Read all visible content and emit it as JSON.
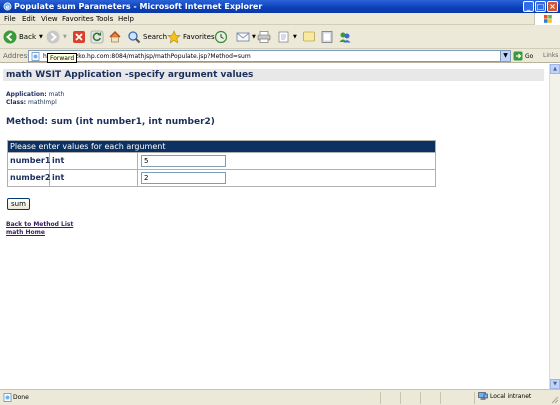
{
  "window": {
    "title": "Populate sum Parameters - Microsoft Internet Explorer",
    "controls": {
      "minimize": "_",
      "maximize": "□",
      "close": "×"
    }
  },
  "menu": [
    "File",
    "Edit",
    "View",
    "Favorites",
    "Tools",
    "Help"
  ],
  "toolbar": {
    "back_label": "Back",
    "search_label": "Search",
    "favorites_label": "Favorites",
    "tooltip": "Forward"
  },
  "address": {
    "label": "Address",
    "url": "http://…m.zko.hp.com:8084/mathjsp/mathPopulate.jsp?Method=sum",
    "go_label": "Go",
    "links_label": "Links"
  },
  "page": {
    "heading": "math WSIT Application -specify argument values",
    "application_label": "Application:",
    "application_value": "math",
    "class_label": "Class:",
    "class_value": "mathImpl",
    "method_title": "Method: sum (int number1, int number2)",
    "table_header": "Please enter values for each argument",
    "args": [
      {
        "name": "number1",
        "type": "int",
        "value": "5"
      },
      {
        "name": "number2",
        "type": "int",
        "value": "2"
      }
    ],
    "submit_label": "sum",
    "back_link": "Back to Method List",
    "home_link": "math Home"
  },
  "status": {
    "text": "Done",
    "zone": "Local intranet"
  },
  "colors": {
    "titlebar": "#0a3fb8",
    "header_bg": "#e8e8e8",
    "table_header_bg": "#0d3262",
    "link": "#3a1d5e"
  }
}
